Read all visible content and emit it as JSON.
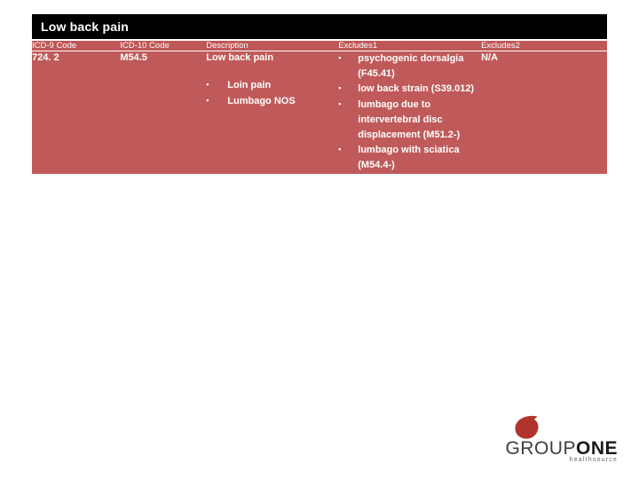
{
  "slide": {
    "title": "Low back pain"
  },
  "table": {
    "headers": [
      "ICD-9 Code",
      "ICD-10 Code",
      "Description",
      "Excludes1",
      "Excludes2"
    ],
    "row": {
      "icd9": "724. 2",
      "icd10": "M54.5",
      "description": "Low back pain",
      "description_sub": [
        "Loin pain",
        "Lumbago NOS"
      ],
      "excludes1": [
        "psychogenic dorsalgia (F45.41)",
        "low back strain (S39.012)",
        "lumbago due to intervertebral disc displacement (M51.2-)",
        "lumbago with sciatica (M54.4-)"
      ],
      "excludes2": "N/A"
    }
  },
  "logo": {
    "word_primary": "GROUP",
    "word_secondary": "ONE",
    "tagline": "healthsource",
    "mark_color": "#b0342c"
  },
  "bullet_glyph": "▪"
}
